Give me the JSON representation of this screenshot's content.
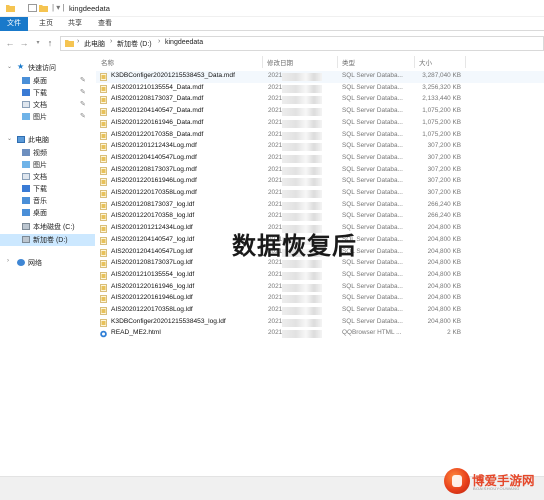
{
  "window": {
    "title": "kingdeedata"
  },
  "ribbon": {
    "tabs": [
      "文件",
      "主页",
      "共享",
      "查看"
    ]
  },
  "address": {
    "crumbs": [
      "此电脑",
      "新加卷 (D:)",
      "kingdeedata"
    ]
  },
  "nav": {
    "quick_access": "快速访问",
    "quick_items": [
      "桌面",
      "下载",
      "文档",
      "图片"
    ],
    "this_pc": "此电脑",
    "pc_items": [
      "视频",
      "图片",
      "文档",
      "下载",
      "音乐",
      "桌面",
      "本地磁盘 (C:)",
      "新加卷 (D:)"
    ],
    "network": "网络",
    "selected": "新加卷 (D:)"
  },
  "columns": {
    "name": "名称",
    "date": "修改日期",
    "type": "类型",
    "size": "大小"
  },
  "files": [
    {
      "name": "K3DBConfiger20201215538453_Data.mdf",
      "date": "2021",
      "type": "SQL Server Databa...",
      "size": "3,287,040 KB",
      "icon": "database-file-icon"
    },
    {
      "name": "AIS20201210135554_Data.mdf",
      "date": "2021",
      "type": "SQL Server Databa...",
      "size": "3,256,320 KB",
      "icon": "database-file-icon"
    },
    {
      "name": "AIS20201208173037_Data.mdf",
      "date": "2021",
      "type": "SQL Server Databa...",
      "size": "2,133,440 KB",
      "icon": "database-file-icon"
    },
    {
      "name": "AIS20201204140547_Data.mdf",
      "date": "2021",
      "type": "SQL Server Databa...",
      "size": "1,075,200 KB",
      "icon": "database-file-icon"
    },
    {
      "name": "AIS20201220161946_Data.mdf",
      "date": "2021",
      "type": "SQL Server Databa...",
      "size": "1,075,200 KB",
      "icon": "database-file-icon"
    },
    {
      "name": "AIS20201220170358_Data.mdf",
      "date": "2021",
      "type": "SQL Server Databa...",
      "size": "1,075,200 KB",
      "icon": "database-file-icon"
    },
    {
      "name": "AIS20201201212434Log.mdf",
      "date": "2021",
      "type": "SQL Server Databa...",
      "size": "307,200 KB",
      "icon": "database-file-icon"
    },
    {
      "name": "AIS20201204140547Log.mdf",
      "date": "2021",
      "type": "SQL Server Databa...",
      "size": "307,200 KB",
      "icon": "database-file-icon"
    },
    {
      "name": "AIS20201208173037Log.mdf",
      "date": "2021",
      "type": "SQL Server Databa...",
      "size": "307,200 KB",
      "icon": "database-file-icon"
    },
    {
      "name": "AIS20201220161946Log.mdf",
      "date": "2021",
      "type": "SQL Server Databa...",
      "size": "307,200 KB",
      "icon": "database-file-icon"
    },
    {
      "name": "AIS20201220170358Log.mdf",
      "date": "2021",
      "type": "SQL Server Databa...",
      "size": "307,200 KB",
      "icon": "database-file-icon"
    },
    {
      "name": "AIS20201208173037_log.ldf",
      "date": "2021",
      "type": "SQL Server Databa...",
      "size": "266,240 KB",
      "icon": "database-file-icon"
    },
    {
      "name": "AIS20201220170358_log.ldf",
      "date": "2021",
      "type": "SQL Server Databa...",
      "size": "266,240 KB",
      "icon": "database-file-icon"
    },
    {
      "name": "AIS20201201212434Log.ldf",
      "date": "2021",
      "type": "SQL Server Databa...",
      "size": "204,800 KB",
      "icon": "database-file-icon"
    },
    {
      "name": "AIS20201204140547_log.ldf",
      "date": "2021",
      "type": "SQL Server Databa...",
      "size": "204,800 KB",
      "icon": "database-file-icon"
    },
    {
      "name": "AIS20201204140547Log.ldf",
      "date": "2021",
      "type": "SQL Server Databa...",
      "size": "204,800 KB",
      "icon": "database-file-icon"
    },
    {
      "name": "AIS20201208173037Log.ldf",
      "date": "2021",
      "type": "SQL Server Databa...",
      "size": "204,800 KB",
      "icon": "database-file-icon"
    },
    {
      "name": "AIS20201210135554_log.ldf",
      "date": "2021",
      "type": "SQL Server Databa...",
      "size": "204,800 KB",
      "icon": "database-file-icon"
    },
    {
      "name": "AIS20201220161946_log.ldf",
      "date": "2021",
      "type": "SQL Server Databa...",
      "size": "204,800 KB",
      "icon": "database-file-icon"
    },
    {
      "name": "AIS20201220161946Log.ldf",
      "date": "2021",
      "type": "SQL Server Databa...",
      "size": "204,800 KB",
      "icon": "database-file-icon"
    },
    {
      "name": "AIS20201220170358Log.ldf",
      "date": "2021",
      "type": "SQL Server Databa...",
      "size": "204,800 KB",
      "icon": "database-file-icon"
    },
    {
      "name": "K3DBConfiger20201215538453_log.ldf",
      "date": "2021",
      "type": "SQL Server Databa...",
      "size": "204,800 KB",
      "icon": "database-file-icon"
    },
    {
      "name": "READ_ME2.html",
      "date": "2021",
      "type": "QQBrowser HTML ...",
      "size": "2 KB",
      "icon": "html-file-icon"
    }
  ],
  "overlay": {
    "caption": "数据恢复后"
  },
  "watermark": {
    "text": "博爱手游网",
    "subtext": "BOAISHOUYOUWANG"
  },
  "colors": {
    "accent": "#1979ca",
    "selection": "#cce8ff",
    "folder": "#f5c451",
    "db_icon": "#e8c15a",
    "watermark": "#e5482a"
  }
}
